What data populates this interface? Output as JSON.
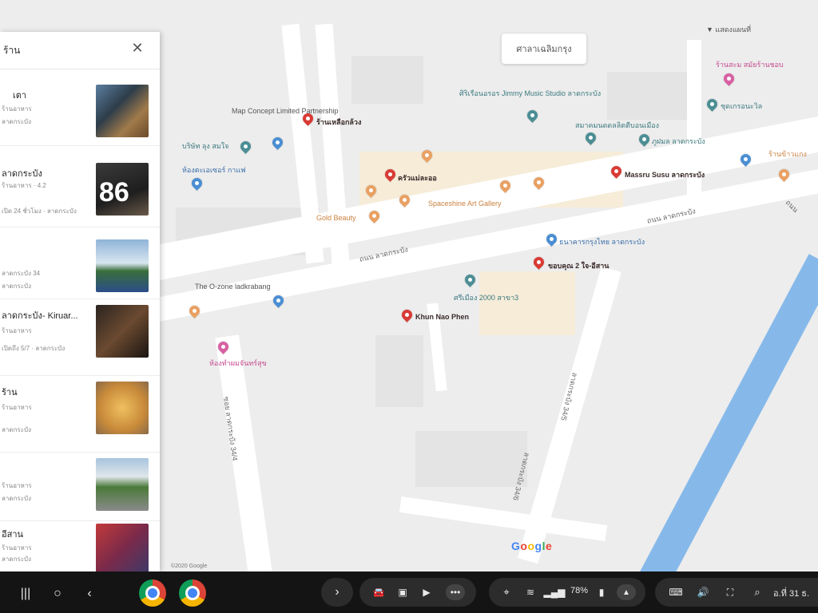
{
  "map": {
    "area_chip": "ศาลาเฉลิมกรุง",
    "top_dropdown": "▼ แสดงแผนที่",
    "google_logo": "Google",
    "copyright": "©2020 Google",
    "road_labels": [
      "ถนน ลาดกระบัง",
      "ถนน ลาดกระบัง",
      "ซอย ลาดกระบัง 34/4",
      "ลาดกระบัง 34/5",
      "ลาดกระบัง 34/6",
      "ถนน"
    ],
    "places": [
      {
        "name": "Map Concept Limited Partnership",
        "color": "gray"
      },
      {
        "name": "ร้านเหลือกล้วง",
        "color": "red"
      },
      {
        "name": "บริษัท ลุง สมใจ",
        "color": "teal"
      },
      {
        "name": "ห้องตะเอเซอร์ กาแฟ",
        "color": "blue"
      },
      {
        "name": "ศิริเรือนอรอร Jimmy Music Studio ลาดกระบัง",
        "color": "teal"
      },
      {
        "name": "สมาคมนดดลลิตตีบอนเมือง",
        "color": "teal"
      },
      {
        "name": "ภูฝมล ลาดกระบัง",
        "color": "teal"
      },
      {
        "name": "ร้านสะม สมัยร้านชอบ",
        "color": "pink"
      },
      {
        "name": "ชุดเกรอนะวิล",
        "color": "teal"
      },
      {
        "name": "ครัวแม่ละออ",
        "color": "red"
      },
      {
        "name": "Spaceshine Art Gallery",
        "color": "orange"
      },
      {
        "name": "Gold Beauty",
        "color": "orange"
      },
      {
        "name": "Massru Susu ลาดกระบัง",
        "color": "red"
      },
      {
        "name": "ร้านข้าวแกง",
        "color": "orange"
      },
      {
        "name": "ธนาคารกรุงไทย ลาดกระบัง",
        "color": "blue"
      },
      {
        "name": "ขอบคุณ 2 ใจ-อีสาน",
        "color": "red"
      },
      {
        "name": "ศรีเมือง 2000 สาขา3",
        "color": "teal"
      },
      {
        "name": "The O-zone ladkrabang",
        "color": "blue"
      },
      {
        "name": "Khun Nao Phen",
        "color": "red"
      },
      {
        "name": "ห้องทำผมจันทร์สุข",
        "color": "pink"
      }
    ]
  },
  "panel": {
    "search_text": "ร้าน",
    "close_label": "✕",
    "results": [
      {
        "title": "เตา",
        "sub1": "ร้านอาหาร",
        "sub2": "ลาดกระบัง"
      },
      {
        "title": "ลาดกระบัง",
        "sub1": "ร้านอาหาร · 4.2",
        "sub2": "เปิด 24 ชั่วโมง · ลาดกระบัง"
      },
      {
        "title": "",
        "sub1": "ลาดกระบัง 34",
        "sub2": "ลาดกระบัง"
      },
      {
        "title": "ลาดกระบัง- Kiruar...",
        "sub1": "ร้านอาหาร",
        "sub2": "เปิดถึง 5/7 · ลาดกระบัง"
      },
      {
        "title": "ร้าน",
        "sub1": "ร้านอาหาร",
        "sub2": "ลาดกระบัง"
      },
      {
        "title": "",
        "sub1": "ร้านอาหาร",
        "sub2": "ลาดกระบัง"
      },
      {
        "title": "อีสาน",
        "sub1": "ร้านอาหาร",
        "sub2": "ลาดกระบัง"
      }
    ],
    "thumb_overlay": "86"
  },
  "taskbar": {
    "battery": "78%",
    "date": "อ.ที่ 31 ธ."
  }
}
